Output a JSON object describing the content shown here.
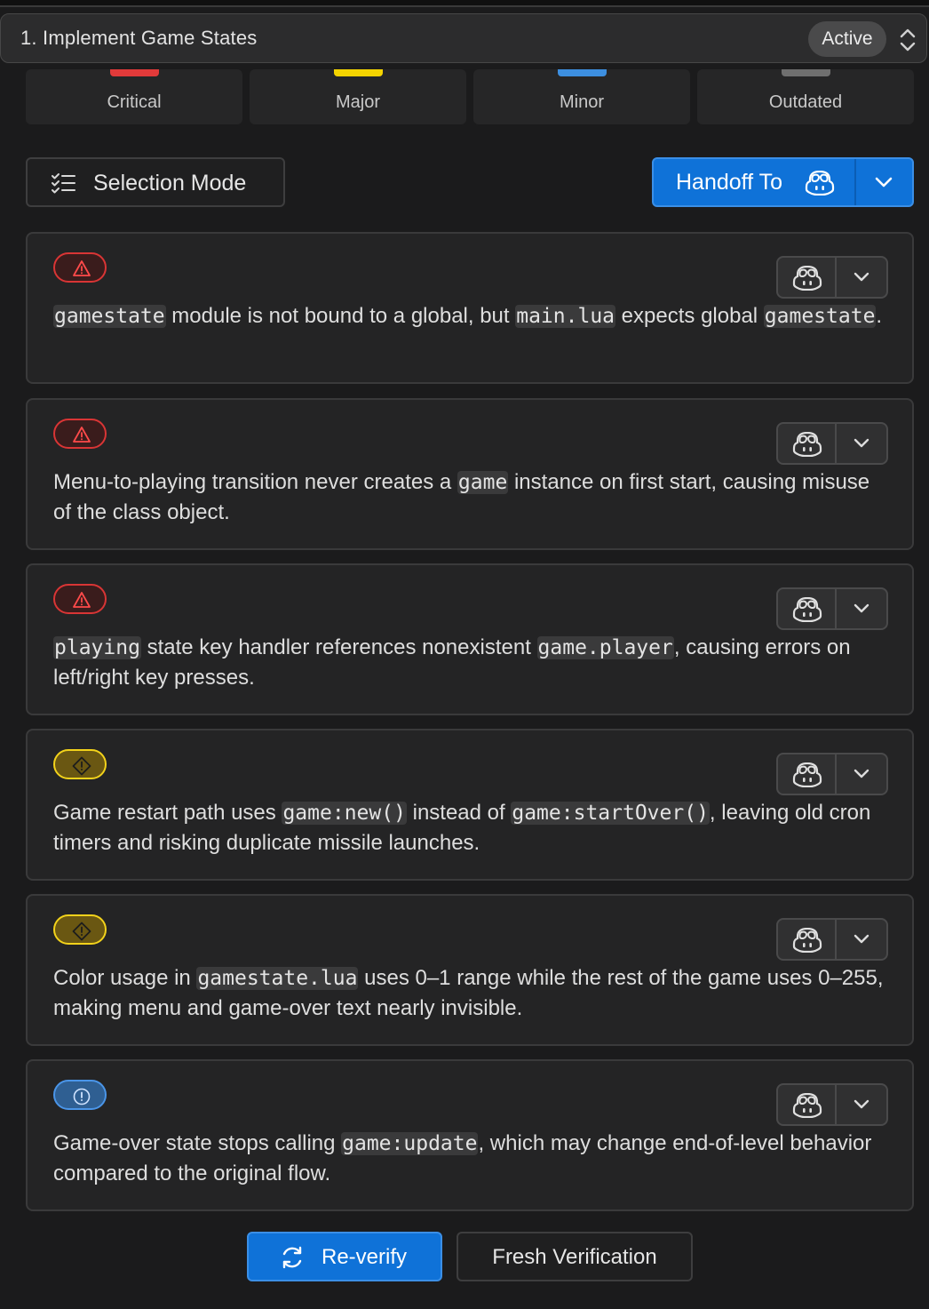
{
  "header": {
    "title": "1. Implement Game States",
    "status": "Active",
    "status_toggle_icon": "chevron-up-down-icon"
  },
  "filters": [
    {
      "label": "Critical",
      "color": "#e23a3a"
    },
    {
      "label": "Major",
      "color": "#f5d400"
    },
    {
      "label": "Minor",
      "color": "#3d8fe0"
    },
    {
      "label": "Outdated",
      "color": "#6f6f6f"
    }
  ],
  "toolbar": {
    "selection_mode_label": "Selection Mode",
    "selection_mode_icon": "checklist-icon",
    "handoff_label": "Handoff To",
    "handoff_icon": "copilot-bot-icon",
    "handoff_dropdown_icon": "chevron-down-icon"
  },
  "issues": [
    {
      "severity": "critical",
      "severity_icon": "warning-triangle-icon",
      "parts": [
        {
          "code": "gamestate"
        },
        {
          "text": " module is not bound to a global, but "
        },
        {
          "code": "main.lua"
        },
        {
          "text": " expects global "
        },
        {
          "code": "gamestate"
        },
        {
          "text": "."
        }
      ]
    },
    {
      "severity": "critical",
      "severity_icon": "warning-triangle-icon",
      "parts": [
        {
          "text": "Menu-to-playing transition never creates a "
        },
        {
          "code": "game"
        },
        {
          "text": " instance on first start, causing misuse of the class object."
        }
      ]
    },
    {
      "severity": "critical",
      "severity_icon": "warning-triangle-icon",
      "parts": [
        {
          "code": "playing"
        },
        {
          "text": " state key handler references nonexistent "
        },
        {
          "code": "game.player"
        },
        {
          "text": ", causing errors on left/right key presses."
        }
      ]
    },
    {
      "severity": "major",
      "severity_icon": "warning-diamond-icon",
      "parts": [
        {
          "text": "Game restart path uses "
        },
        {
          "code": "game:new()"
        },
        {
          "text": " instead of "
        },
        {
          "code": "game:startOver()"
        },
        {
          "text": ", leaving old cron timers and risking duplicate missile launches."
        }
      ]
    },
    {
      "severity": "major",
      "severity_icon": "warning-diamond-icon",
      "parts": [
        {
          "text": "Color usage in "
        },
        {
          "code": "gamestate.lua"
        },
        {
          "text": " uses 0–1 range while the rest of the game uses 0–255, making menu and game-over text nearly invisible."
        }
      ]
    },
    {
      "severity": "minor",
      "severity_icon": "info-circle-icon",
      "parts": [
        {
          "text": "Game-over state stops calling "
        },
        {
          "code": "game:update"
        },
        {
          "text": ", which may change end-of-level behavior compared to the original flow."
        }
      ]
    }
  ],
  "issue_actions": {
    "bot_icon": "copilot-bot-icon",
    "dropdown_icon": "chevron-down-icon"
  },
  "footer": {
    "reverify_label": "Re-verify",
    "reverify_icon": "refresh-icon",
    "fresh_label": "Fresh Verification"
  },
  "colors": {
    "accent": "#0f72d8",
    "critical": "#d93535",
    "major": "#f2d21b",
    "minor": "#4a95e8"
  }
}
